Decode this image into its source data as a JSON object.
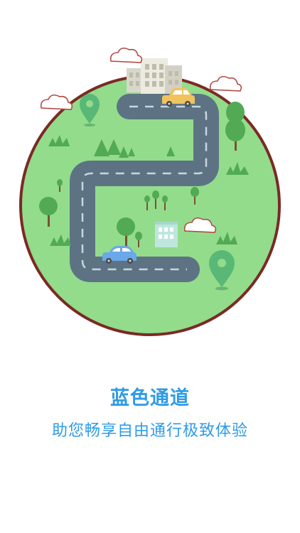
{
  "onboarding": {
    "title": "蓝色通道",
    "subtitle": "助您畅享自由通行极致体验"
  },
  "colors": {
    "accent": "#2f9be6",
    "ground": "#92dc8c",
    "rim": "#7b2a24",
    "road": "#5d7383",
    "lane_mark": "#c7d6df",
    "tree": "#52aa55",
    "trunk": "#7a5134",
    "pin": "#59b876"
  },
  "icons": [
    "map-pin-icon",
    "car-icon",
    "building-icon",
    "tree-icon",
    "cloud-icon",
    "grass-icon"
  ]
}
